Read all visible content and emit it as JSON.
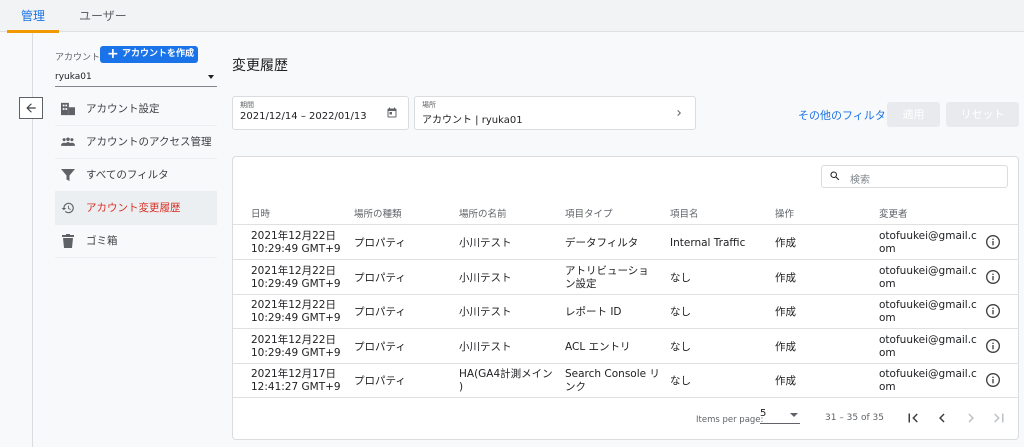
{
  "tabs": [
    {
      "label": "管理",
      "active": true
    },
    {
      "label": "ユーザー",
      "active": false
    }
  ],
  "account": {
    "label": "アカウント",
    "create_button": "アカウントを作成",
    "selected": "ryuka01"
  },
  "sidebar": {
    "items": [
      {
        "label": "アカウント設定",
        "icon": "building-icon",
        "active": false
      },
      {
        "label": "アカウントのアクセス管理",
        "icon": "people-icon",
        "active": false
      },
      {
        "label": "すべてのフィルタ",
        "icon": "filter-icon",
        "active": false
      },
      {
        "label": "アカウント変更履歴",
        "icon": "history-icon",
        "active": true
      },
      {
        "label": "ゴミ箱",
        "icon": "trash-icon",
        "active": false
      }
    ]
  },
  "page": {
    "title": "変更履歴"
  },
  "filters": {
    "period_label": "期間",
    "period_value": "2021/12/14 – 2022/01/13",
    "location_label": "場所",
    "location_value": "アカウント | ryuka01",
    "more_filters": "その他のフィルタ",
    "apply": "適用",
    "reset": "リセット"
  },
  "search": {
    "placeholder": "検索"
  },
  "table": {
    "headers": [
      "日時",
      "場所の種類",
      "場所の名前",
      "項目タイプ",
      "項目名",
      "操作",
      "変更者"
    ],
    "rows": [
      {
        "date1": "2021年12月22日",
        "date2": "10:29:49 GMT+9",
        "loc_type": "プロパティ",
        "loc_name1": "小川テスト",
        "loc_name2": "",
        "item_type1": "データフィルタ",
        "item_type2": "",
        "item_name": "Internal Traffic",
        "op": "作成",
        "user1": "otofuukei@gmail.c",
        "user2": "om"
      },
      {
        "date1": "2021年12月22日",
        "date2": "10:29:49 GMT+9",
        "loc_type": "プロパティ",
        "loc_name1": "小川テスト",
        "loc_name2": "",
        "item_type1": "アトリビューショ",
        "item_type2": "ン設定",
        "item_name": "なし",
        "op": "作成",
        "user1": "otofuukei@gmail.c",
        "user2": "om"
      },
      {
        "date1": "2021年12月22日",
        "date2": "10:29:49 GMT+9",
        "loc_type": "プロパティ",
        "loc_name1": "小川テスト",
        "loc_name2": "",
        "item_type1": "レポート ID",
        "item_type2": "",
        "item_name": "なし",
        "op": "作成",
        "user1": "otofuukei@gmail.c",
        "user2": "om"
      },
      {
        "date1": "2021年12月22日",
        "date2": "10:29:49 GMT+9",
        "loc_type": "プロパティ",
        "loc_name1": "小川テスト",
        "loc_name2": "",
        "item_type1": "ACL エントリ",
        "item_type2": "",
        "item_name": "なし",
        "op": "作成",
        "user1": "otofuukei@gmail.c",
        "user2": "om"
      },
      {
        "date1": "2021年12月17日",
        "date2": "12:41:27 GMT+9",
        "loc_type": "プロパティ",
        "loc_name1": "HA(GA4計測メイン",
        "loc_name2": ")",
        "item_type1": "Search Console リ",
        "item_type2": "ンク",
        "item_name": "なし",
        "op": "作成",
        "user1": "otofuukei@gmail.c",
        "user2": "om"
      }
    ]
  },
  "pagination": {
    "items_per_page_label": "Items per page:",
    "items_per_page": "5",
    "range": "31 – 35 of 35"
  },
  "colors": {
    "accent": "#1a73e8",
    "active_tab_underline": "#f29900",
    "active_nav_text": "#d93025"
  }
}
